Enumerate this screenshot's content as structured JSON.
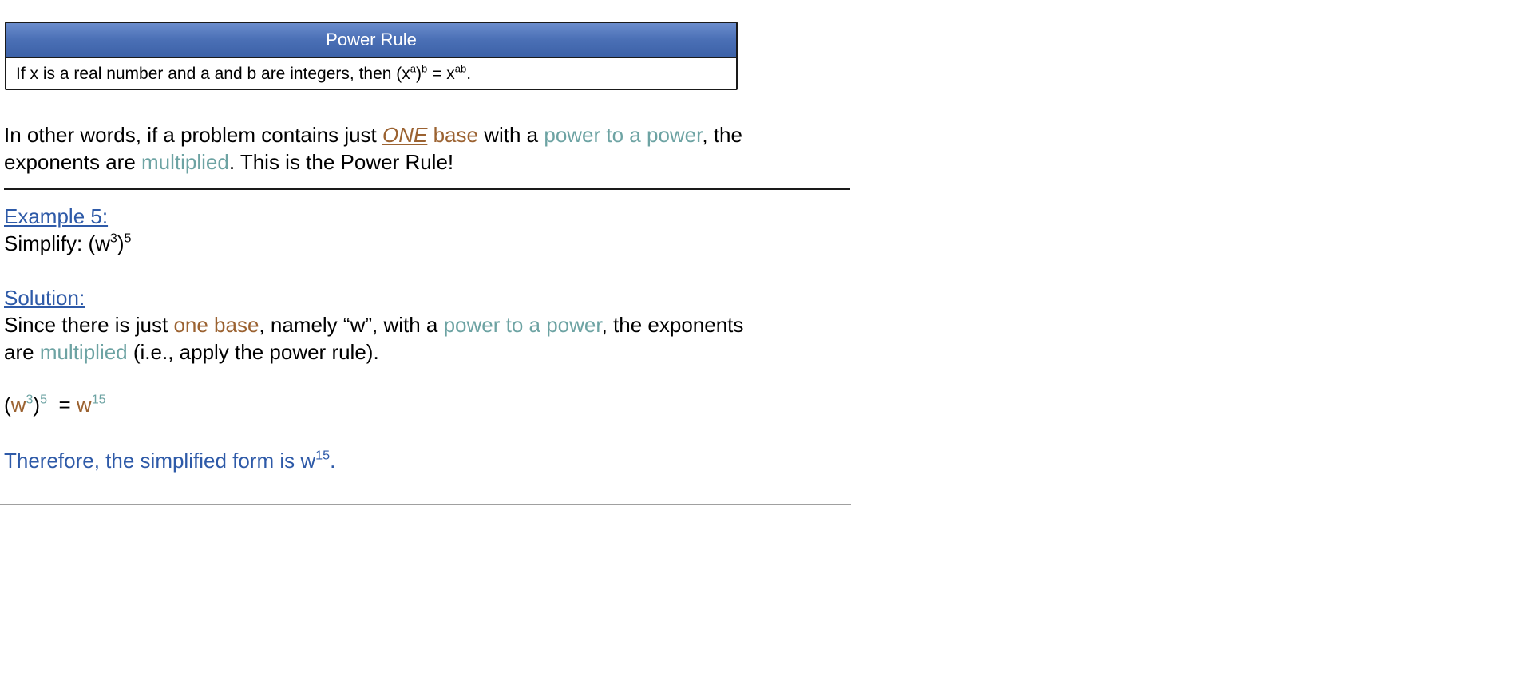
{
  "rule_box": {
    "title": "Power Rule",
    "statement_prefix": "If x is a real number and a and b are integers, then (x",
    "sup_a": "a",
    "close_paren": ")",
    "sup_b": "b",
    "equals_x": " = x",
    "sup_ab": "ab",
    "period": "."
  },
  "intro": {
    "t1": "In other words, if a problem contains just ",
    "one": "ONE",
    "space1": " ",
    "base": "base",
    "t2": " with a ",
    "power_to_power": "power to a power",
    "t3": ", the",
    "t4": "exponents are ",
    "multiplied": "multiplied",
    "t5": ".  This is the Power Rule!"
  },
  "example": {
    "heading": "Example 5:",
    "simplify_prefix": "Simplify:  (w",
    "sup3": "3",
    "close": ")",
    "sup5": "5"
  },
  "solution": {
    "heading": "Solution:",
    "s1": "Since there is just ",
    "one_base": "one base",
    "s2": ", namely “w”, with a ",
    "power_to_power": "power to a power",
    "s3": ", the exponents",
    "s4": "are ",
    "multiplied": "multiplied",
    "s5": " (i.e., apply the power rule)."
  },
  "equation": {
    "open": "(",
    "w1": "w",
    "sup3": "3",
    "close": ")",
    "sup5": "5",
    "equals": "  = ",
    "w2": "w",
    "sup15": "15"
  },
  "conclusion": {
    "text": "Therefore, the simplified form is w",
    "sup15": "15",
    "period": "."
  },
  "colors": {
    "header_blue": "#4a6fb5",
    "orange": "#9b6231",
    "teal": "#6da3a3",
    "link_blue": "#2e5aa8"
  }
}
